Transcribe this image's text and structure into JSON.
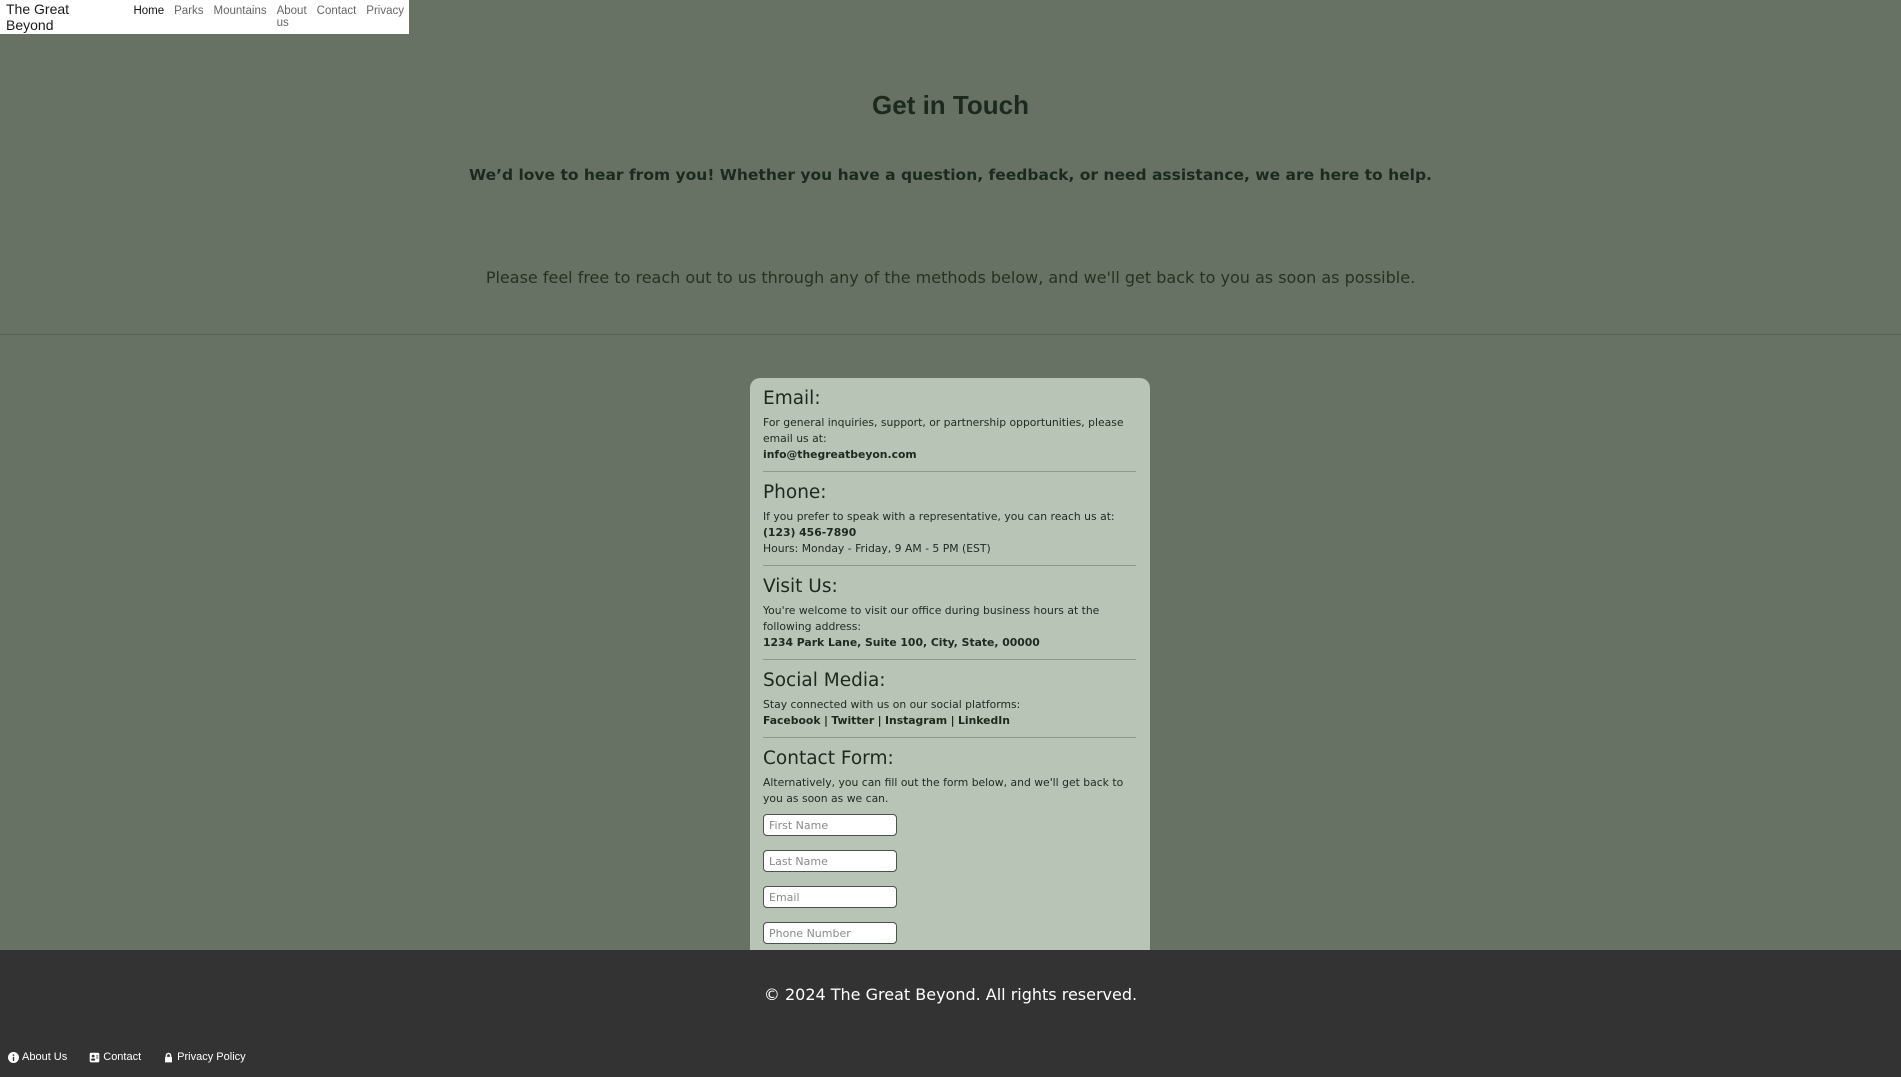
{
  "navbar": {
    "brand": "The Great Beyond",
    "links": [
      {
        "label": "Home",
        "active": true
      },
      {
        "label": "Parks"
      },
      {
        "label": "Mountains"
      },
      {
        "label": "About us"
      },
      {
        "label": "Contact"
      },
      {
        "label": "Privacy"
      }
    ]
  },
  "hero": {
    "title": "Get in Touch",
    "lead": "We’d love to hear from you! Whether you have a question, feedback, or need assistance, we are here to help.",
    "body": "Please feel free to reach out to us through any of the methods below, and we'll get back to you as soon as possible."
  },
  "card": {
    "email": {
      "heading": "Email:",
      "text": "For general inquiries, support, or partnership opportunities, please email us at:",
      "address": "info@thegreatbeyon.com"
    },
    "phone": {
      "heading": "Phone:",
      "text": "If you prefer to speak with a representative, you can reach us at:",
      "number": "(123) 456-7890",
      "hours": "Hours: Monday - Friday, 9 AM - 5 PM (EST)"
    },
    "visit": {
      "heading": "Visit Us:",
      "text": "You're welcome to visit our office during business hours at the following address:",
      "address": "1234 Park Lane, Suite 100, City, State, 00000"
    },
    "social": {
      "heading": "Social Media:",
      "text": "Stay connected with us on our social platforms:",
      "links": [
        "Facebook",
        "Twitter",
        "Instagram",
        "LinkedIn"
      ],
      "separator": "|"
    },
    "form": {
      "heading": "Contact Form:",
      "text": "Alternatively, you can fill out the form below, and we'll get back to you as soon as we can.",
      "first_name_placeholder": "First Name",
      "last_name_placeholder": "Last Name",
      "email_placeholder": "Email",
      "phone_placeholder": "Phone Number"
    }
  },
  "footer": {
    "copyright": "© 2024 The Great Beyond. All rights reserved.",
    "links": [
      {
        "label": "About Us",
        "icon": "info-icon"
      },
      {
        "label": "Contact",
        "icon": "contact-card-icon"
      },
      {
        "label": "Privacy Policy",
        "icon": "lock-icon"
      }
    ]
  },
  "colors": {
    "page_background": "#687264",
    "card_background": "#b8c4b6",
    "footer_background": "#333333",
    "heading_text": "#1b2a1c"
  }
}
